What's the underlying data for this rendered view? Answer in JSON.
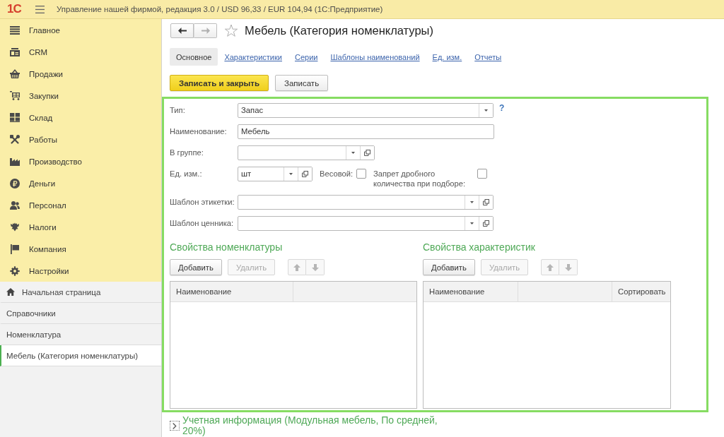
{
  "app_bar": {
    "logo": "1С",
    "title": "Управление нашей фирмой, редакция 3.0 / USD 96,33 / EUR 104,94 (1С:Предприятие)"
  },
  "sections": [
    {
      "label": "Главное",
      "selected": false
    },
    {
      "label": "CRM",
      "selected": false
    },
    {
      "label": "Продажи",
      "selected": false
    },
    {
      "label": "Закупки",
      "selected": false
    },
    {
      "label": "Склад",
      "selected": false
    },
    {
      "label": "Работы",
      "selected": false
    },
    {
      "label": "Производство",
      "selected": false
    },
    {
      "label": "Деньги",
      "selected": false
    },
    {
      "label": "Персонал",
      "selected": false
    },
    {
      "label": "Налоги",
      "selected": false
    },
    {
      "label": "Компания",
      "selected": false
    },
    {
      "label": "Настройки",
      "selected": false
    }
  ],
  "pages": [
    {
      "label": "Начальная страница",
      "selected": false
    },
    {
      "label": "Справочники",
      "selected": false
    },
    {
      "label": "Номенклатура",
      "selected": false
    },
    {
      "label": "Мебель (Категория номенклатуры)",
      "selected": true
    }
  ],
  "form": {
    "nav": [
      {
        "kind": "back",
        "disabled": false
      },
      {
        "kind": "forward",
        "disabled": true
      }
    ],
    "favorite": false,
    "title": "Мебель (Категория номенклатуры)"
  },
  "tabs": [
    {
      "label": "Основное",
      "selected": true
    },
    {
      "label": "Характеристики",
      "selected": false
    },
    {
      "label": "Серии",
      "selected": false
    },
    {
      "label": "Шаблоны наименований",
      "selected": false
    },
    {
      "label": "Ед. изм.",
      "selected": false
    },
    {
      "label": "Отчеты",
      "selected": false
    }
  ],
  "commands": [
    {
      "label": "Записать и закрыть",
      "default": true
    },
    {
      "label": "Записать",
      "default": false
    }
  ],
  "fields": [
    {
      "label": "Тип:",
      "kind": "select",
      "value": "Запас",
      "help": "?"
    },
    {
      "label": "Наименование:",
      "kind": "text",
      "value": "Мебель"
    },
    {
      "label": "В группе:",
      "kind": "select_open"
    },
    {
      "label": "Ед. изм.:",
      "kind": "select_open",
      "value": "шт",
      "checks": [
        {
          "label": "Весовой:",
          "checked": false
        },
        {
          "label": "Запрет дробного количества при подборе:",
          "checked": false
        }
      ]
    },
    {
      "label": "Шаблон этикетки:",
      "kind": "select_open"
    },
    {
      "label": "Шаблон ценника:",
      "kind": "select_open"
    }
  ],
  "panels": [
    {
      "title": "Свойства номенклатуры",
      "buttons": [
        {
          "label": "Добавить",
          "disabled": false
        },
        {
          "label": "Удалить",
          "disabled": true
        }
      ],
      "move_disabled": true,
      "columns": [
        {
          "kind": "text",
          "title": "Наименование"
        },
        {
          "kind": "blank"
        }
      ]
    },
    {
      "title": "Свойства характеристик",
      "buttons": [
        {
          "label": "Добавить",
          "disabled": false
        },
        {
          "label": "Удалить",
          "disabled": true
        }
      ],
      "move_disabled": true,
      "columns": [
        {
          "kind": "text",
          "title": "Наименование"
        },
        {
          "kind": "blank"
        },
        {
          "kind": "text",
          "title": "Сортировать"
        }
      ]
    }
  ],
  "accounting": {
    "label": "Учетная информация (Модульная мебель, По средней, 20%)",
    "expanded": false
  }
}
